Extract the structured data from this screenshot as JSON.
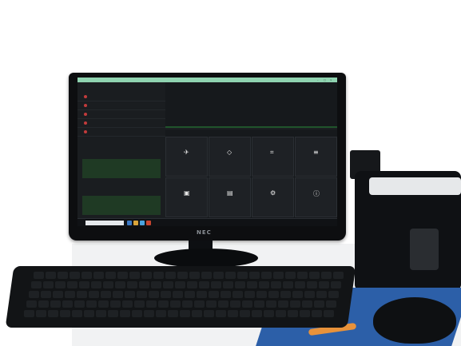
{
  "monitor": {
    "brand": "NEC"
  },
  "screen": {
    "left_rows": [
      {
        "name": "",
        "value": ""
      },
      {
        "name": "",
        "value": ""
      },
      {
        "name": "",
        "value": ""
      },
      {
        "name": "",
        "value": ""
      },
      {
        "name": "",
        "value": ""
      }
    ],
    "tiles": [
      {
        "icon": "plane-icon",
        "label": ""
      },
      {
        "icon": "tag-icon",
        "label": ""
      },
      {
        "icon": "scan-icon",
        "label": ""
      },
      {
        "icon": "menu-icon",
        "label": ""
      },
      {
        "icon": "box-icon",
        "label": ""
      },
      {
        "icon": "document-icon",
        "label": ""
      },
      {
        "icon": "gear-icon",
        "label": ""
      },
      {
        "icon": "info-icon",
        "label": ""
      }
    ]
  }
}
